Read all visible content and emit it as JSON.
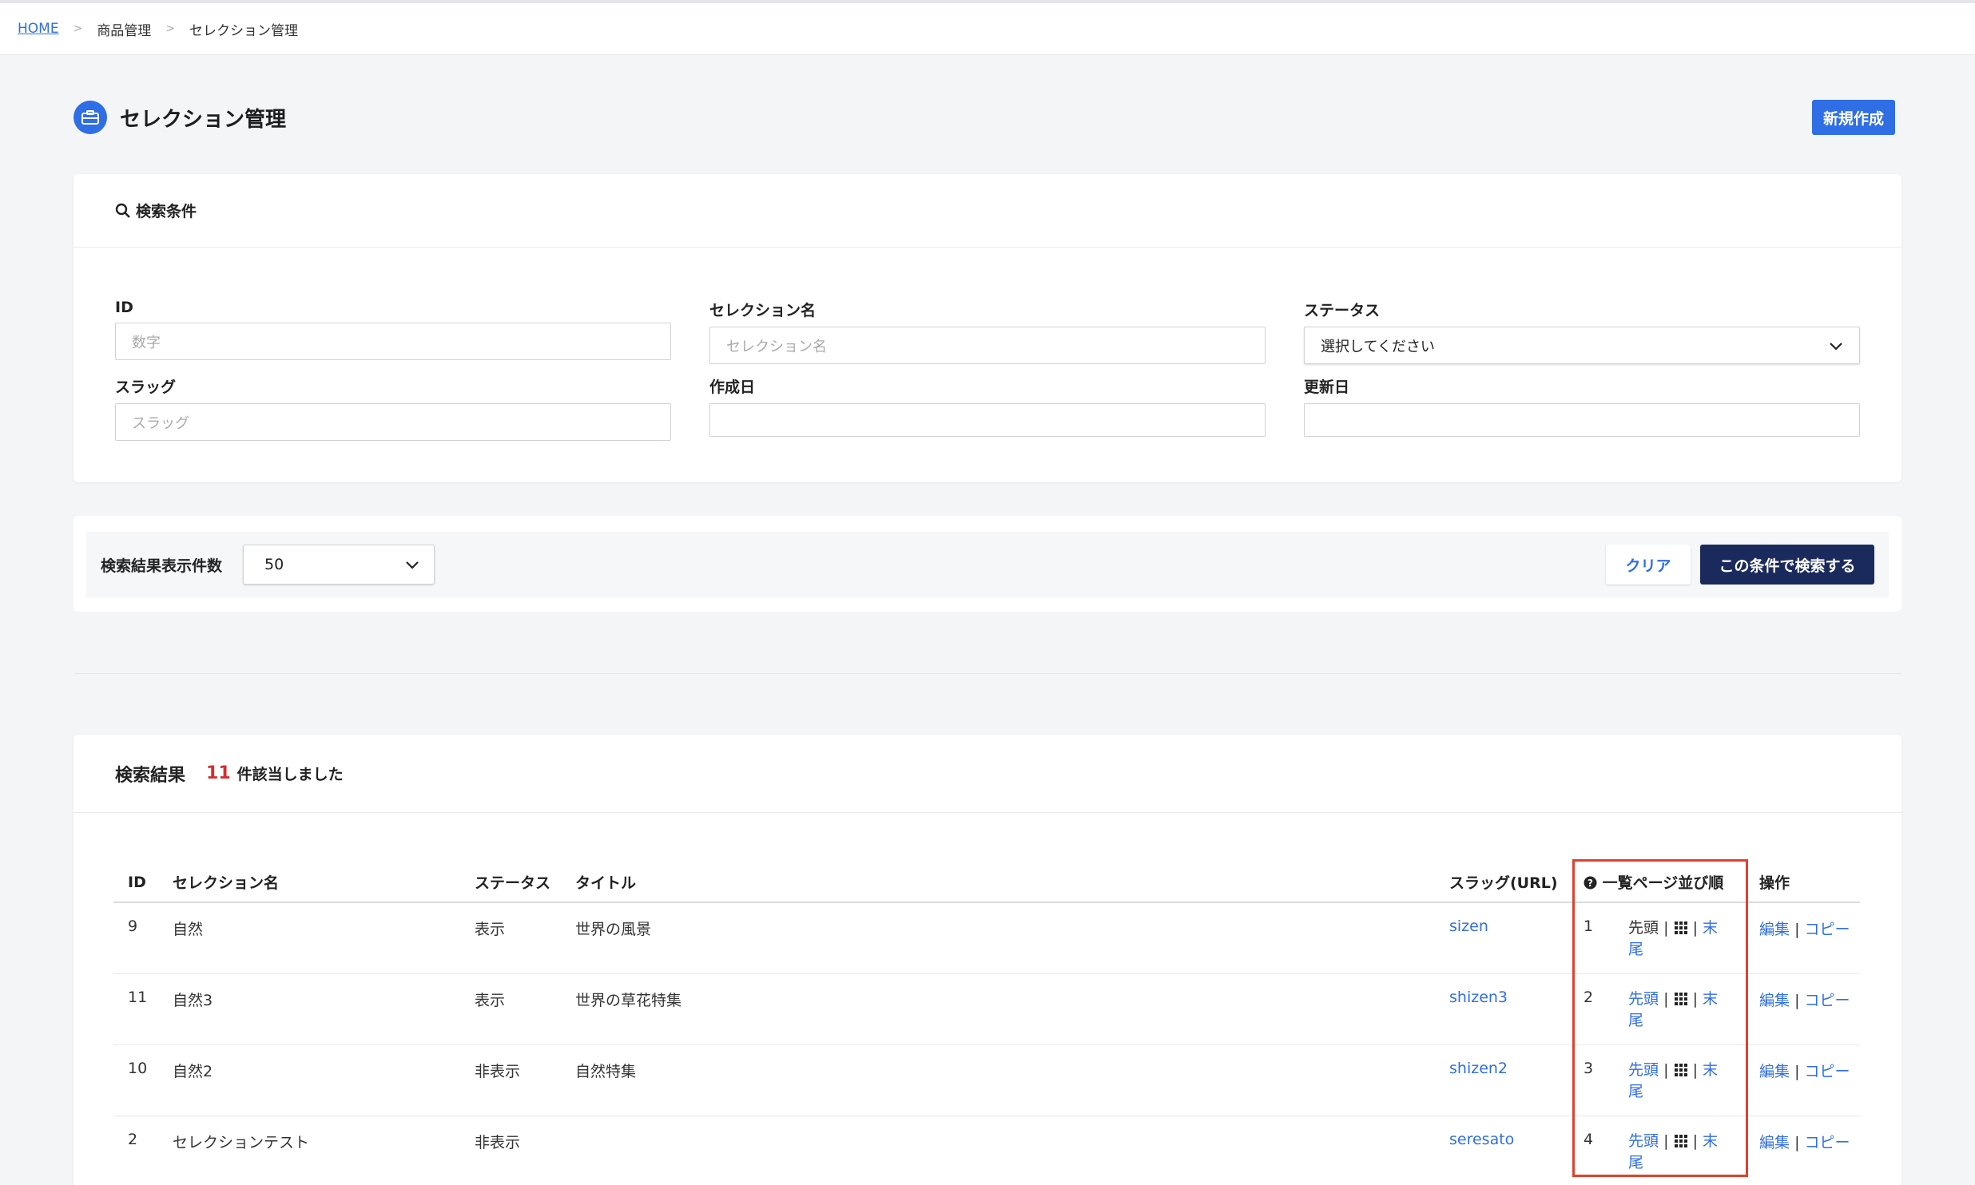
{
  "breadcrumb": {
    "home": "HOME",
    "items": [
      "商品管理",
      "セレクション管理"
    ],
    "separator": ">"
  },
  "page": {
    "title": "セレクション管理",
    "new_button": "新規作成"
  },
  "search": {
    "title": "検索条件",
    "fields": {
      "id": {
        "label": "ID",
        "placeholder": "数字"
      },
      "name": {
        "label": "セレクション名",
        "placeholder": "セレクション名"
      },
      "status": {
        "label": "ステータス",
        "value": "選択してください"
      },
      "slug": {
        "label": "スラッグ",
        "placeholder": "スラッグ"
      },
      "created": {
        "label": "作成日",
        "placeholder": ""
      },
      "updated": {
        "label": "更新日",
        "placeholder": ""
      }
    }
  },
  "controls": {
    "count_label": "検索結果表示件数",
    "count_value": "50",
    "clear": "クリア",
    "search": "この条件で検索する"
  },
  "results": {
    "title": "検索結果",
    "count": "11",
    "count_suffix": "件該当しました",
    "columns": [
      "ID",
      "セレクション名",
      "ステータス",
      "タイトル",
      "スラッグ(URL)",
      "一覧ページ並び順",
      "操作"
    ],
    "sort_links": {
      "first": "先頭",
      "sep": "|",
      "last": "末尾"
    },
    "action_links": {
      "edit": "編集",
      "sep": "|",
      "copy": "コピー"
    },
    "rows": [
      {
        "id": "9",
        "name": "自然",
        "status": "表示",
        "title": "世界の風景",
        "slug": "sizen",
        "order": "1"
      },
      {
        "id": "11",
        "name": "自然3",
        "status": "表示",
        "title": "世界の草花特集",
        "slug": "shizen3",
        "order": "2"
      },
      {
        "id": "10",
        "name": "自然2",
        "status": "非表示",
        "title": "自然特集",
        "slug": "shizen2",
        "order": "3"
      },
      {
        "id": "2",
        "name": "セレクションテスト",
        "status": "非表示",
        "title": "",
        "slug": "seresato",
        "order": "4"
      }
    ]
  },
  "colors": {
    "accent": "#2f6ee5",
    "primary_dark": "#1b2a5c",
    "highlight": "#e0412d",
    "count": "#d32f2f"
  }
}
